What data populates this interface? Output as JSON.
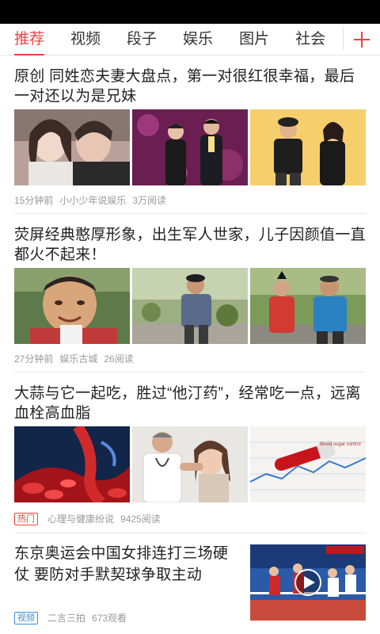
{
  "tabs": [
    {
      "label": "推荐",
      "active": true
    },
    {
      "label": "视频",
      "active": false
    },
    {
      "label": "段子",
      "active": false
    },
    {
      "label": "娱乐",
      "active": false
    },
    {
      "label": "图片",
      "active": false
    },
    {
      "label": "社会",
      "active": false
    }
  ],
  "add_icon": "plus-icon",
  "colors": {
    "accent": "#f04142",
    "video_tag": "#3d8fd6",
    "meta": "#999999"
  },
  "articles": [
    {
      "title": "原创 同姓恋夫妻大盘点，第一对很红很幸福，最后一对还以为是兄妹",
      "time": "15分钟前",
      "source": "小小少年说娱乐",
      "reads": "3万阅读"
    },
    {
      "title": "荧屏经典憨厚形象，出生军人世家，儿子因颜值一直都火不起来！",
      "time": "27分钟前",
      "source": "娱乐古城",
      "reads": "26阅读"
    },
    {
      "title": "大蒜与它一起吃，胜过“他汀药”，经常吃一点，远离血栓高血脂",
      "tag": "热门",
      "source": "心理与健康纷说",
      "reads": "9425阅读",
      "thumb_text": "Blood sugar control"
    },
    {
      "title": "东京奥运会中国女排连打三场硬仗 要防对手默契球争取主动",
      "tag": "视频",
      "source": "二言三拍",
      "reads": "673观看"
    }
  ]
}
